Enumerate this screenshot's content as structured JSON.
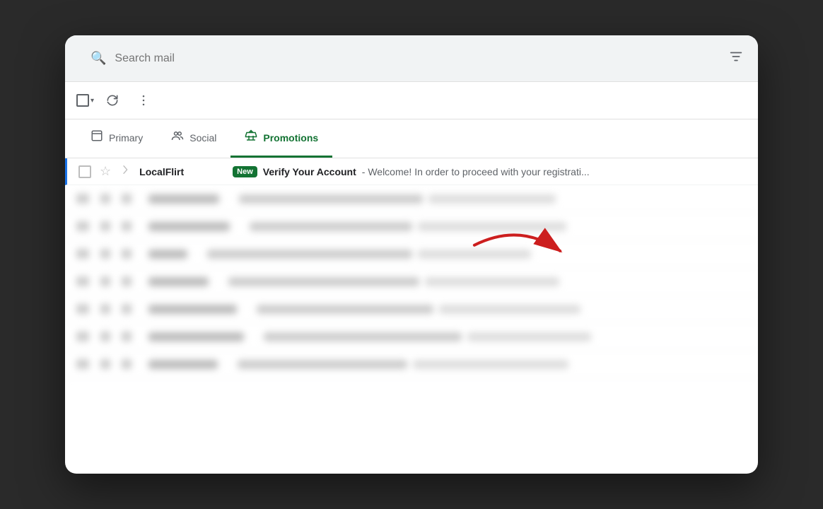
{
  "search": {
    "placeholder": "Search mail"
  },
  "toolbar": {
    "refresh_label": "↺",
    "more_label": "⋮",
    "checkbox_aria": "Select all"
  },
  "tabs": [
    {
      "id": "primary",
      "label": "Primary",
      "icon": "🖥",
      "active": false
    },
    {
      "id": "social",
      "label": "Social",
      "icon": "👥",
      "active": false
    },
    {
      "id": "promotions",
      "label": "Promotions",
      "icon": "🏷",
      "active": true
    }
  ],
  "emails": [
    {
      "id": 1,
      "sender": "LocalFlirt",
      "badge": "New",
      "subject": "Verify Your Account",
      "preview": "- Welcome! In order to proceed with your registrati...",
      "unread": true,
      "blurred": false
    }
  ],
  "blurred_rows": [
    {
      "sender_width": 100,
      "text_width": 300
    },
    {
      "sender_width": 110,
      "text_width": 280
    },
    {
      "sender_width": 60,
      "text_width": 320
    },
    {
      "sender_width": 90,
      "text_width": 300
    },
    {
      "sender_width": 120,
      "text_width": 260
    },
    {
      "sender_width": 130,
      "text_width": 290
    },
    {
      "sender_width": 95,
      "text_width": 310
    }
  ],
  "colors": {
    "accent_blue": "#1a73e8",
    "accent_green": "#137333",
    "arrow_red": "#cc1e1e"
  }
}
